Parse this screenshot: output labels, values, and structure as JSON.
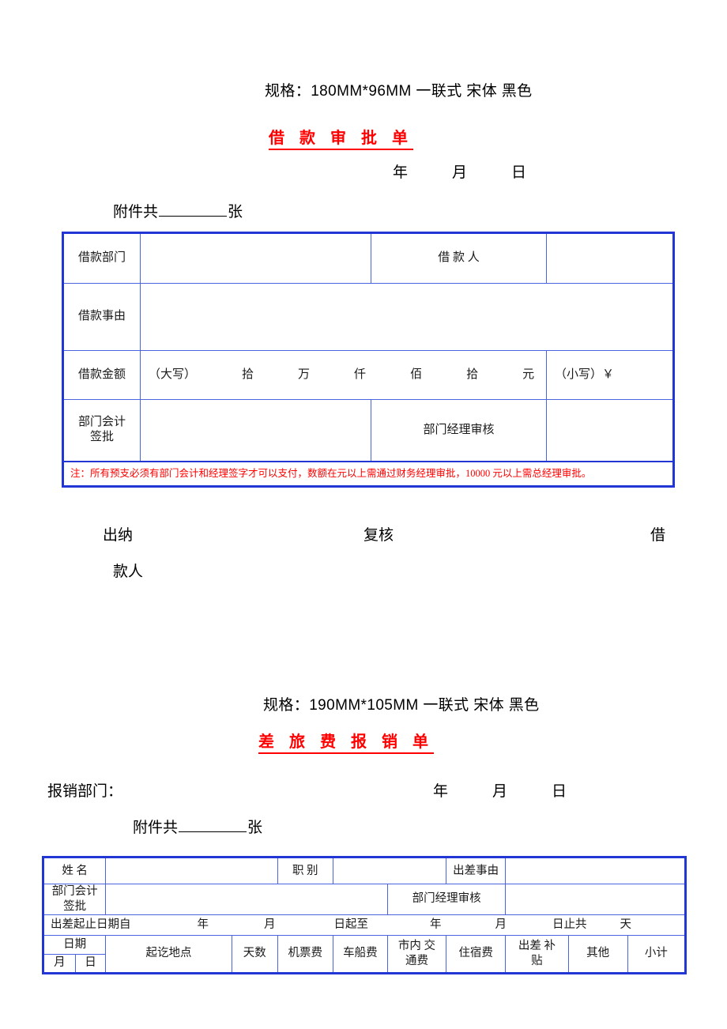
{
  "document": {
    "background_color": "#ffffff",
    "table_border_color": "#2136d4",
    "accent_red": "#ff0000"
  },
  "form1": {
    "spec": "规格：180MM*96MM 一联式 宋体 黑色",
    "title": "借 款 审 批 单",
    "date": {
      "year": "年",
      "month": "月",
      "day": "日"
    },
    "attachment": {
      "prefix": "附件共",
      "suffix": "张"
    },
    "table": {
      "row1": {
        "label1": "借款部门",
        "value1": "",
        "label2": "借 款 人",
        "value2": ""
      },
      "row2": {
        "label": "借款事由",
        "value": ""
      },
      "row3": {
        "label": "借款金额",
        "capital_prefix": "（大写）",
        "units": [
          "拾",
          "万",
          "仟",
          "佰",
          "拾",
          "元"
        ],
        "lowercase_label": "（小写）￥"
      },
      "row4": {
        "label1": "部门会计",
        "label1b": "签批",
        "value1": "",
        "label2": "部门经理审核",
        "value2": ""
      },
      "note": "注：所有预支必须有部门会计和经理签字才可以支付，数额在元以上需通过财务经理审批，10000 元以上需总经理审批。"
    },
    "footer": {
      "cashier": "出纳",
      "review": "复核",
      "borrower_part1": "借",
      "borrower_part2": "款人"
    }
  },
  "form2": {
    "spec": "规格：190MM*105MM 一联式 宋体 黑色",
    "title": "差 旅 费 报 销 单",
    "department_label": "报销部门：",
    "date": {
      "year": "年",
      "month": "月",
      "day": "日"
    },
    "attachment": {
      "prefix": "附件共",
      "suffix": "张"
    },
    "table": {
      "row1": {
        "label1": "姓 名",
        "value1": "",
        "label2": "职 别",
        "value2": "",
        "label3": "出差事由",
        "value3": ""
      },
      "row2": {
        "label1": "部门会计签批",
        "value1": "",
        "label2": "部门经理审核",
        "value2": ""
      },
      "row3": {
        "prefix": "出差起止日期自",
        "year1": "年",
        "month1": "月",
        "day_from": "日起至",
        "year2": "年",
        "month2": "月",
        "day_to": "日止共",
        "days": "天"
      },
      "headers": {
        "date_group": "日期",
        "date_month": "月",
        "date_day": "日",
        "route": "起讫地点",
        "days": "天数",
        "airfare": "机票费",
        "transport_fare": "车船费",
        "city_transport_1": "市内 交",
        "city_transport_2": "通费",
        "lodging": "住宿费",
        "allowance_1": "出差 补",
        "allowance_2": "贴",
        "other": "其他",
        "subtotal": "小计"
      }
    }
  }
}
